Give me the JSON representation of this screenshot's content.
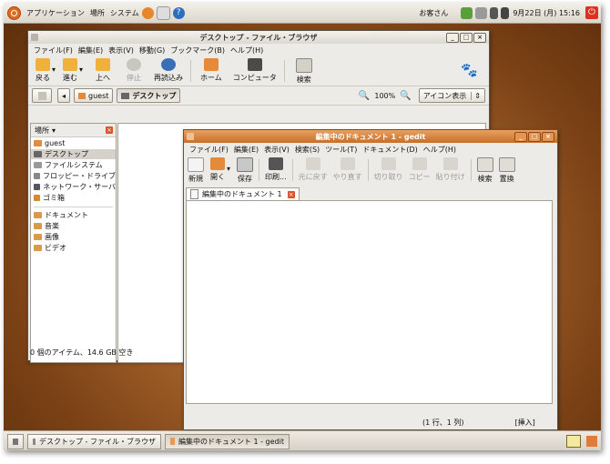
{
  "top_panel": {
    "menus": [
      "アプリケーション",
      "場所",
      "システム"
    ],
    "user": "お客さん",
    "datetime": "9月22日 (月) 15:16"
  },
  "file_browser": {
    "title": "デスクトップ - ファイル・ブラウザ",
    "menus": [
      "ファイル(F)",
      "編集(E)",
      "表示(V)",
      "移動(G)",
      "ブックマーク(B)",
      "ヘルプ(H)"
    ],
    "toolbar": [
      {
        "label": "戻る",
        "icon": "back-arrow-icon",
        "dropdown": true
      },
      {
        "label": "進む",
        "icon": "forward-arrow-icon",
        "dropdown": true
      },
      {
        "label": "上へ",
        "icon": "up-arrow-icon"
      },
      {
        "label": "停止",
        "icon": "stop-icon",
        "disabled": true
      },
      {
        "label": "再読込み",
        "icon": "reload-icon"
      },
      {
        "label": "ホーム",
        "icon": "home-icon"
      },
      {
        "label": "コンピュータ",
        "icon": "computer-icon"
      },
      {
        "label": "検索",
        "icon": "search-icon"
      }
    ],
    "location": {
      "crumbs": [
        "guest",
        "デスクトップ"
      ],
      "zoom": "100%",
      "view_mode": "アイコン表示"
    },
    "sidebar": {
      "header": "場所",
      "items": [
        {
          "label": "guest",
          "icon": "home-folder-icon"
        },
        {
          "label": "デスクトップ",
          "icon": "desktop-icon",
          "selected": true
        },
        {
          "label": "ファイルシステム",
          "icon": "drive-icon"
        },
        {
          "label": "フロッピー・ドライブ",
          "icon": "floppy-icon"
        },
        {
          "label": "ネットワーク・サーバ",
          "icon": "network-icon"
        },
        {
          "label": "ゴミ箱",
          "icon": "trash-icon"
        }
      ],
      "bookmarks": [
        {
          "label": "ドキュメント",
          "icon": "folder-icon"
        },
        {
          "label": "音楽",
          "icon": "folder-icon"
        },
        {
          "label": "画像",
          "icon": "folder-icon"
        },
        {
          "label": "ビデオ",
          "icon": "folder-icon"
        }
      ]
    },
    "status": "0 個のアイテム、14.6 GB 空き"
  },
  "gedit": {
    "title": "編集中のドキュメント 1 - gedit",
    "menus": [
      "ファイル(F)",
      "編集(E)",
      "表示(V)",
      "検索(S)",
      "ツール(T)",
      "ドキュメント(D)",
      "ヘルプ(H)"
    ],
    "toolbar": [
      {
        "label": "新規",
        "icon": "new-document-icon"
      },
      {
        "label": "開く",
        "icon": "open-icon",
        "dropdown": true
      },
      {
        "label": "保存",
        "icon": "save-icon"
      },
      {
        "label": "印刷...",
        "icon": "print-icon"
      },
      {
        "label": "元に戻す",
        "icon": "undo-icon",
        "disabled": true
      },
      {
        "label": "やり直す",
        "icon": "redo-icon",
        "disabled": true
      },
      {
        "label": "切り取り",
        "icon": "cut-icon",
        "disabled": true
      },
      {
        "label": "コピー",
        "icon": "copy-icon",
        "disabled": true
      },
      {
        "label": "貼り付け",
        "icon": "paste-icon",
        "disabled": true
      },
      {
        "label": "検索",
        "icon": "find-icon"
      },
      {
        "label": "置換",
        "icon": "replace-icon"
      }
    ],
    "tab": "編集中のドキュメント 1",
    "cursor": "(1 行、1 列)",
    "mode": "[挿入]"
  },
  "taskbar": {
    "tasks": [
      "デスクトップ - ファイル・ブラウザ",
      "編集中のドキュメント 1 - gedit"
    ]
  },
  "colors": {
    "accent": "#d9532c",
    "title_active": "#c66f2a",
    "desktop": "#a8652d"
  }
}
